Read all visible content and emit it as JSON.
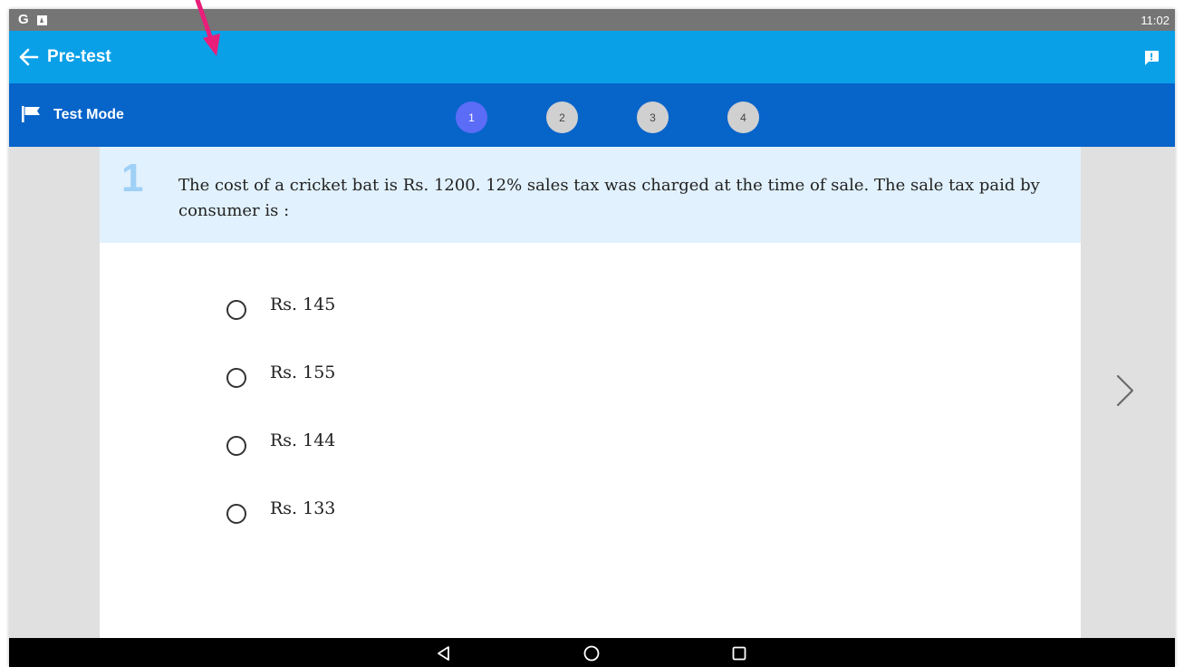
{
  "status_bar": {
    "left_icons": [
      "G",
      "android-notification-icon"
    ],
    "time": "11:02"
  },
  "app_bar": {
    "title": "Pre-test",
    "back_icon": "arrow-left-icon",
    "action_icon": "feedback-icon"
  },
  "mode_bar": {
    "label": "Test Mode",
    "icon": "flag-icon",
    "questions": [
      "1",
      "2",
      "3",
      "4"
    ],
    "current_question": "1"
  },
  "question": {
    "number": "1",
    "text": "The cost of a cricket bat is Rs. 1200. 12% sales tax was charged at the time of sale. The sale tax paid by consumer is :",
    "options": [
      "Rs. 145",
      "Rs. 155",
      "Rs. 144",
      "Rs. 133"
    ]
  },
  "colors": {
    "app_bar": "#0aa0e8",
    "mode_bar": "#0764c9",
    "current_question": "#5b6cf6",
    "question_bg": "#e1f1fd",
    "annotation_arrow": "#e91e7a"
  }
}
